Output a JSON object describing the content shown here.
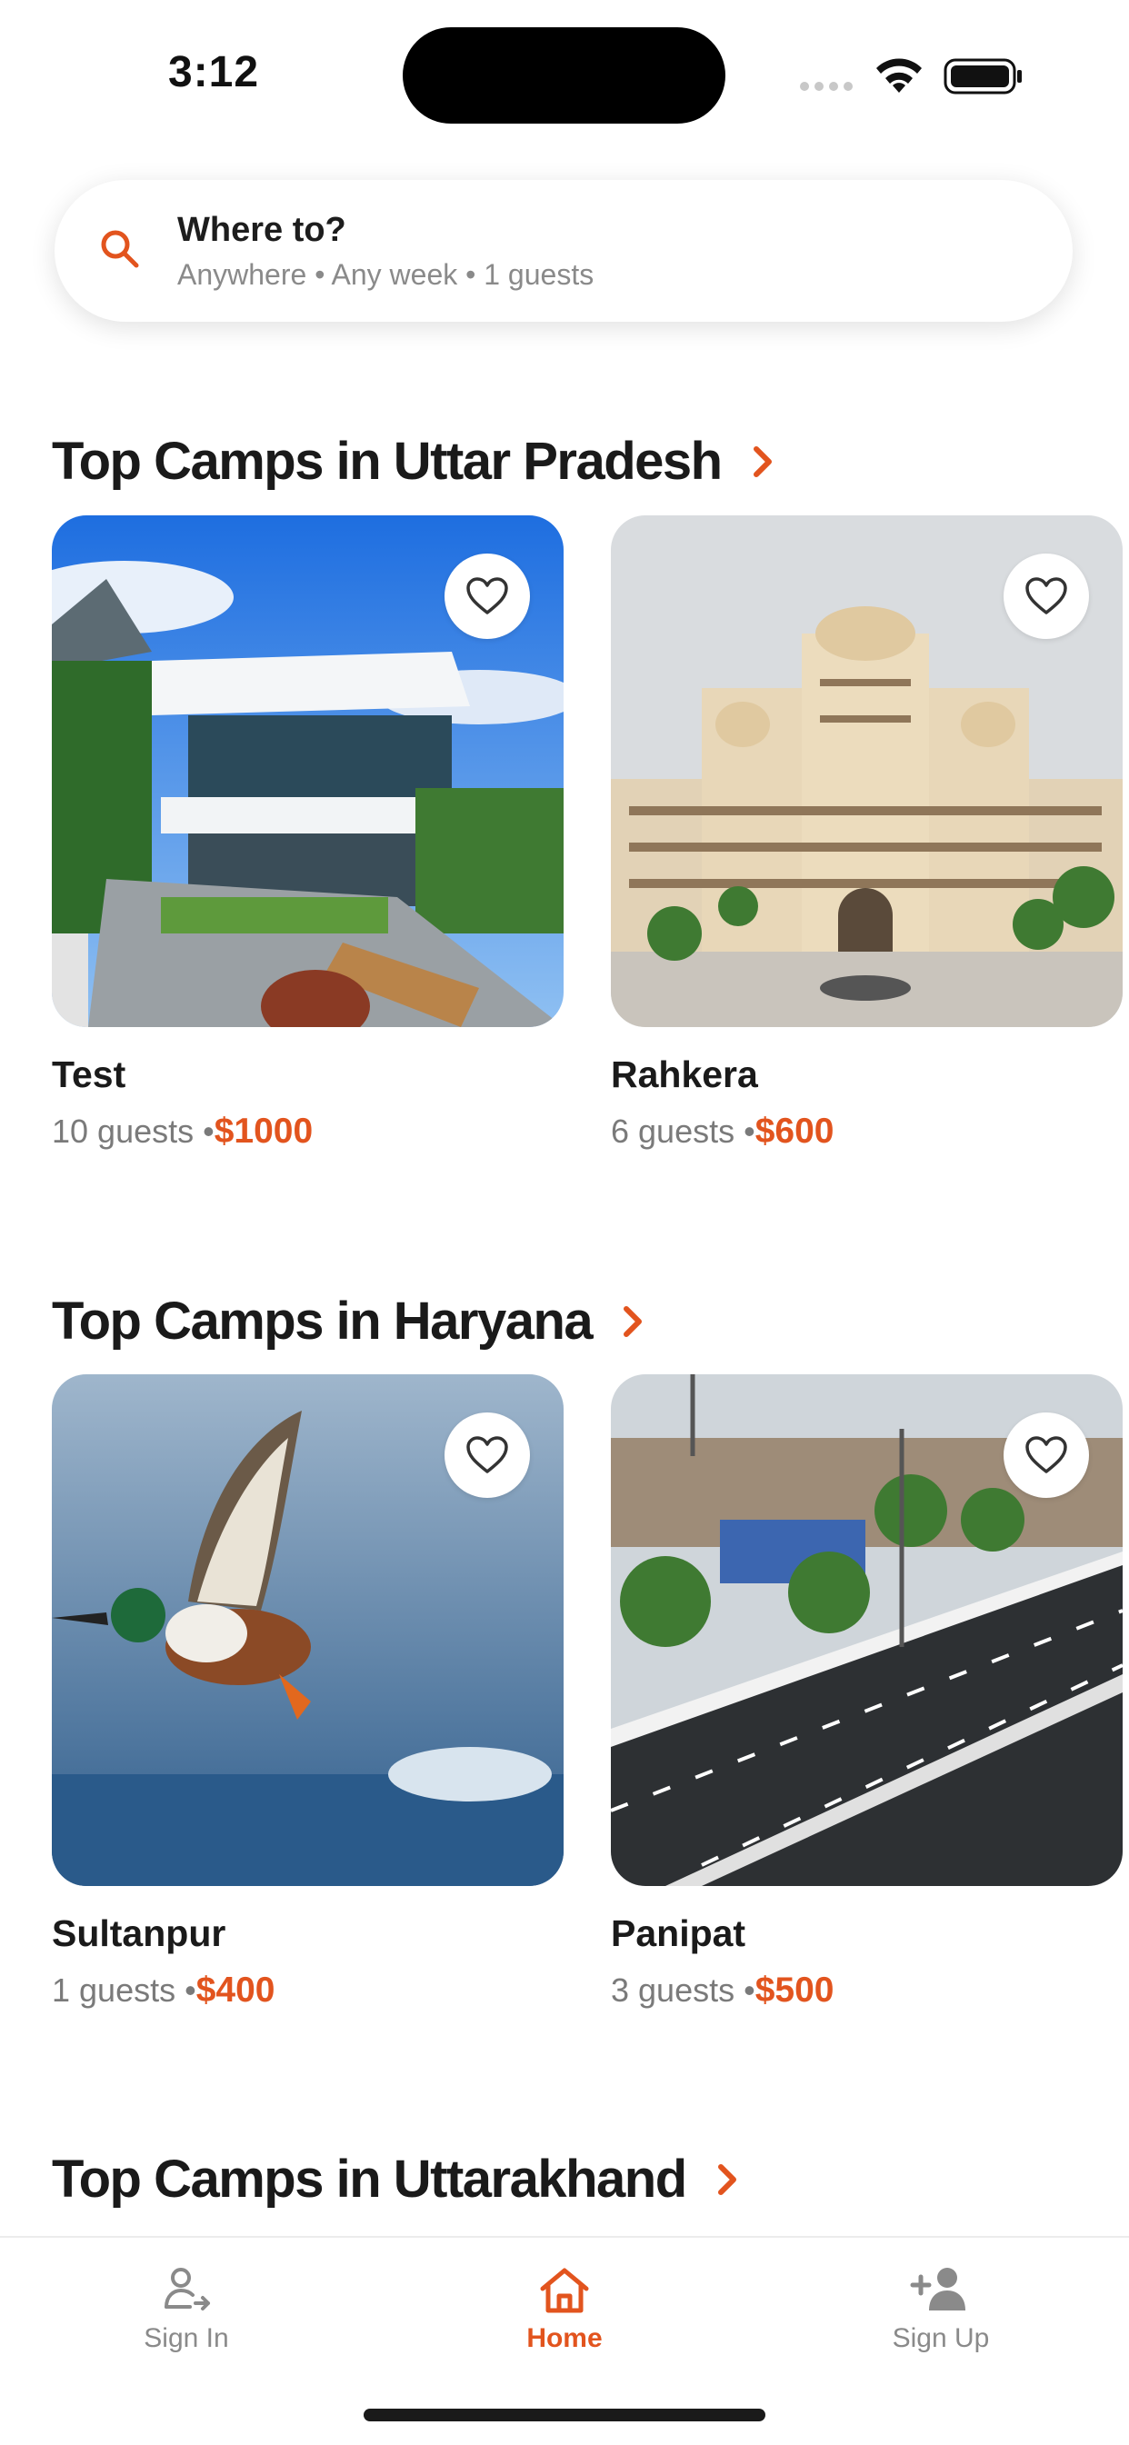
{
  "status_bar": {
    "time": "3:12"
  },
  "search": {
    "title": "Where to?",
    "subtitle": "Anywhere • Any week • 1 guests"
  },
  "sections": [
    {
      "title": "Top Camps in Uttar Pradesh",
      "cards": [
        {
          "name": "Test",
          "guests": "10 guests •",
          "price": "$1000",
          "image": "modern villa"
        },
        {
          "name": "Rahkera",
          "guests": "6 guests •",
          "price": "$600",
          "image": "palace"
        }
      ]
    },
    {
      "title": "Top Camps in Haryana",
      "cards": [
        {
          "name": "Sultanpur",
          "guests": "1 guests •",
          "price": "$400",
          "image": "duck over water"
        },
        {
          "name": "Panipat",
          "guests": "3 guests •",
          "price": "$500",
          "image": "highway"
        }
      ]
    },
    {
      "title": "Top Camps in Uttarakhand",
      "cards": []
    }
  ],
  "tabbar": {
    "items": [
      {
        "label": "Sign In",
        "icon": "sign-in-icon",
        "active": false
      },
      {
        "label": "Home",
        "icon": "home-icon",
        "active": true
      },
      {
        "label": "Sign Up",
        "icon": "add-user-icon",
        "active": false
      }
    ]
  },
  "colors": {
    "accent": "#e2541e",
    "muted": "#8a8a8a",
    "text": "#1a1a1a"
  }
}
